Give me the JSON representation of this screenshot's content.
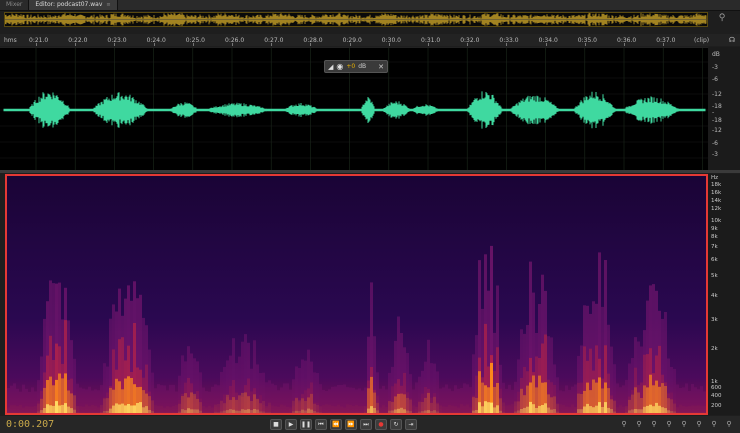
{
  "tabs": [
    {
      "label": "Mixer",
      "active": false
    },
    {
      "label": "Editor: podcast07.wav",
      "active": true
    }
  ],
  "ruler": {
    "unit_label": "hms",
    "end_label": "(clip)",
    "ticks": [
      "0:21.0",
      "0:22.0",
      "0:23.0",
      "0:24.0",
      "0:25.0",
      "0:26.0",
      "0:27.0",
      "0:28.0",
      "0:29.0",
      "0:30.0",
      "0:31.0",
      "0:32.0",
      "0:33.0",
      "0:34.0",
      "0:35.0",
      "0:36.0",
      "0:37.0"
    ]
  },
  "db_scale": [
    "dB",
    "-3",
    "-6",
    "-12",
    "-18",
    "-",
    "-18",
    "-12",
    "-6",
    "-3"
  ],
  "hud": {
    "value": "+0",
    "unit": "dB"
  },
  "hz_scale": [
    "Hz",
    "18k",
    "16k",
    "14k",
    "12k",
    "10k",
    "9k",
    "8k",
    "7k",
    "6k",
    "5k",
    "4k",
    "3k",
    "2k",
    "1k",
    "600",
    "400",
    "200"
  ],
  "time_display": "0:00.207",
  "transport": {
    "buttons": [
      "stop",
      "play",
      "pause",
      "go-start",
      "rewind",
      "fast-forward",
      "go-end",
      "record",
      "loop",
      "skip-selection"
    ]
  },
  "zoom_buttons": [
    "zoom-in-amplitude",
    "zoom-out-amplitude",
    "zoom-in-time",
    "zoom-out-time",
    "zoom-out-full",
    "zoom-in-selection",
    "zoom-to-left",
    "zoom-to-right"
  ],
  "colors": {
    "waveform": "#3fd9a0",
    "overview_waveform": "#c9a227",
    "spectral_border": "#e53935",
    "time_display": "#c9a94a",
    "hud_value": "#e8b000"
  }
}
